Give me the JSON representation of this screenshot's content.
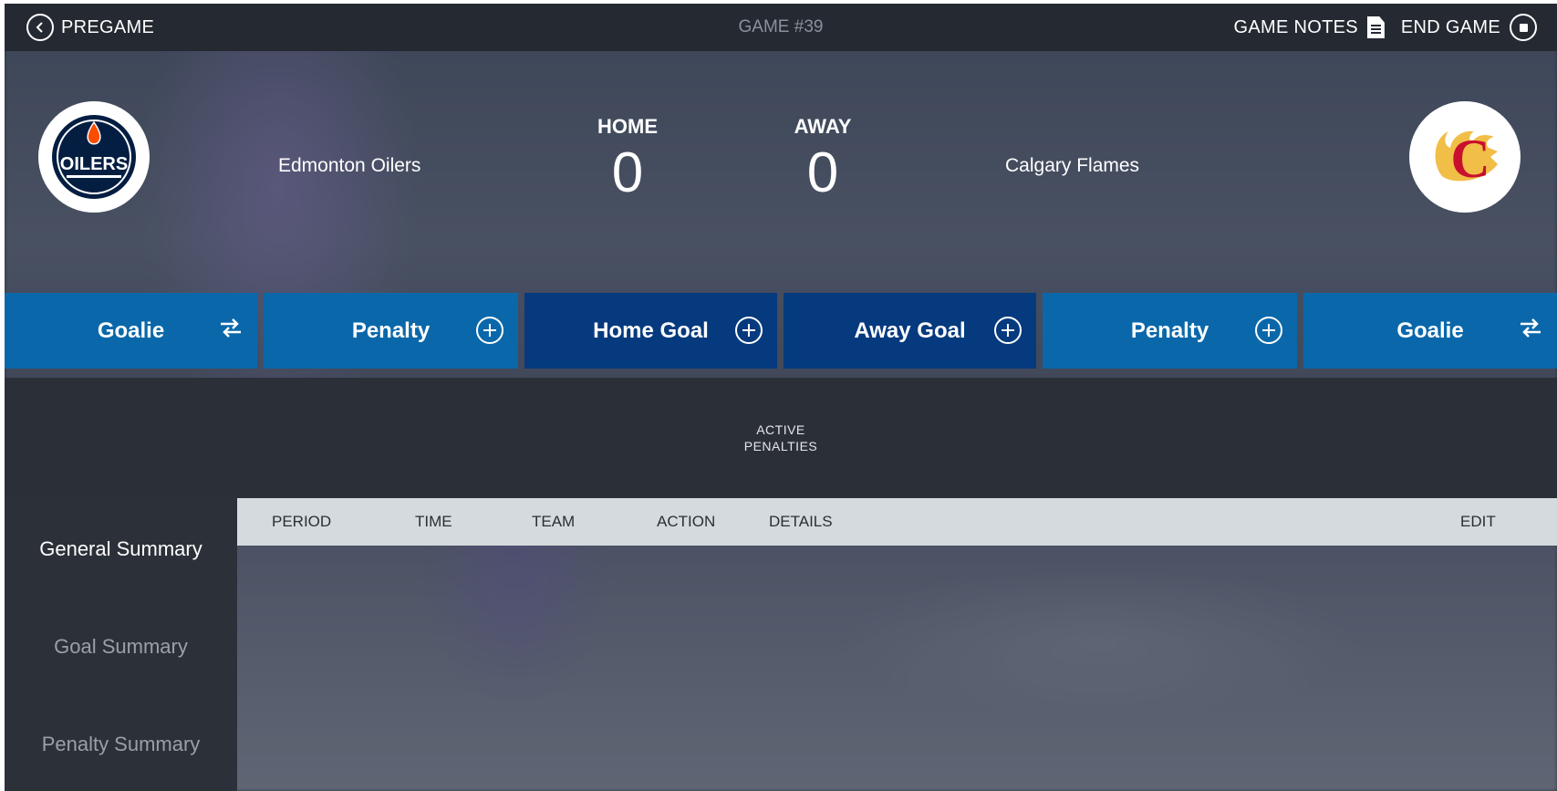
{
  "topbar": {
    "back_label": "PREGAME",
    "game_label": "GAME #39",
    "notes_label": "GAME NOTES",
    "end_label": "END GAME"
  },
  "home": {
    "logo_text": "OILERS",
    "name": "Edmonton Oilers",
    "label": "HOME",
    "score": "0",
    "colors": {
      "primary": "#041e42",
      "accent": "#fc4c02"
    }
  },
  "away": {
    "logo_text": "C",
    "name": "Calgary Flames",
    "label": "AWAY",
    "score": "0",
    "colors": {
      "primary": "#c8102e",
      "accent": "#f1be48"
    }
  },
  "actions": [
    {
      "label": "Goalie",
      "icon": "swap-icon"
    },
    {
      "label": "Penalty",
      "icon": "plus-circle-icon"
    },
    {
      "label": "Home Goal",
      "icon": "plus-circle-icon"
    },
    {
      "label": "Away Goal",
      "icon": "plus-circle-icon"
    },
    {
      "label": "Penalty",
      "icon": "plus-circle-icon"
    },
    {
      "label": "Goalie",
      "icon": "swap-icon"
    }
  ],
  "active_penalties": {
    "line1": "ACTIVE",
    "line2": "PENALTIES"
  },
  "side_menu": [
    {
      "label": "General Summary",
      "active": true
    },
    {
      "label": "Goal Summary",
      "active": false
    },
    {
      "label": "Penalty Summary",
      "active": false
    }
  ],
  "table": {
    "columns": [
      "PERIOD",
      "TIME",
      "TEAM",
      "ACTION",
      "DETAILS",
      "EDIT"
    ],
    "rows": []
  },
  "theme": {
    "topbar_bg": "#252a32",
    "action_light": "#0a68aa",
    "action_dark": "#063a7e",
    "header_bg": "#d5dade"
  }
}
